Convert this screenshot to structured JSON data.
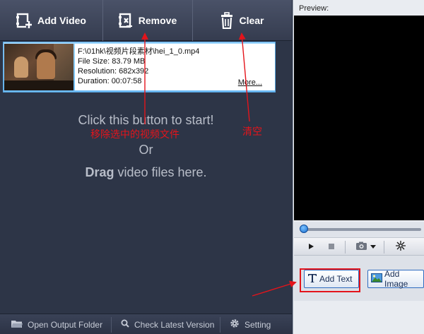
{
  "toolbar": {
    "add_video_label": "Add Video",
    "remove_label": "Remove",
    "clear_label": "Clear"
  },
  "file_item": {
    "path": "F:\\01hk\\视频片段素材\\hei_1_0.mp4",
    "file_size": "File Size: 83.79 MB",
    "resolution": "Resolution: 682x392",
    "duration": "Duration: 00:07:58",
    "more_link": "More..."
  },
  "hints": {
    "start": "Click this button to start!",
    "or": "Or",
    "drag_bold": "Drag",
    "drag_rest": " video files here."
  },
  "annotations": {
    "remove_note": "移除选中的视频文件",
    "clear_note": "清空"
  },
  "bottom_bar": {
    "open_output": "Open Output Folder",
    "check_version": "Check Latest Version",
    "setting": "Setting"
  },
  "preview": {
    "label": "Preview:",
    "seek_position": 0.0
  },
  "actions": {
    "add_text": "Add Text",
    "add_image": "Add Image"
  },
  "icons": {
    "add_video": "add-video-icon",
    "remove": "remove-icon",
    "clear": "trash-icon",
    "open_folder": "folder-icon",
    "check_version": "search-icon",
    "setting": "gear-icon",
    "play": "play-icon",
    "stop": "stop-icon",
    "snapshot": "camera-icon",
    "effects": "sparkle-icon",
    "text": "text-icon",
    "image": "image-icon"
  },
  "colors": {
    "annotation_red": "#e4141b",
    "selection_blue": "#6dbcf6",
    "panel_dark": "#2d3547"
  }
}
